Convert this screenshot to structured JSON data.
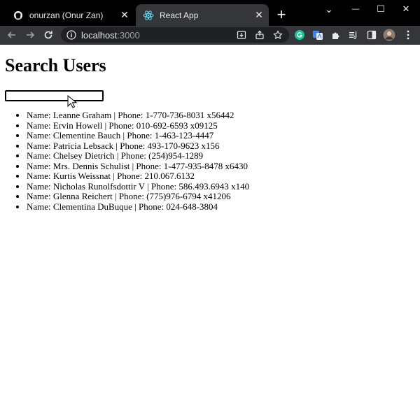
{
  "browser": {
    "tabs": [
      {
        "title": "onurzan (Onur Zan)",
        "icon": "github-icon",
        "active": false
      },
      {
        "title": "React App",
        "icon": "react-icon",
        "active": true
      }
    ],
    "close_glyph": "✕",
    "new_tab_glyph": "+",
    "address": {
      "host": "localhost",
      "port": ":3000"
    },
    "window_controls": {
      "minimize": "—",
      "maximize": "☐",
      "close": "✕",
      "expand": "⌄"
    },
    "colors": {
      "tabstrip": "#000000",
      "toolbar": "#35363a",
      "grammarly": "#15c39a",
      "translate": "#4285f4"
    }
  },
  "page": {
    "heading": "Search Users",
    "search": {
      "value": "",
      "placeholder": ""
    },
    "users": [
      {
        "name": "Leanne Graham",
        "phone": "1-770-736-8031 x56442"
      },
      {
        "name": "Ervin Howell",
        "phone": "010-692-6593 x09125"
      },
      {
        "name": "Clementine Bauch",
        "phone": "1-463-123-4447"
      },
      {
        "name": "Patricia Lebsack",
        "phone": "493-170-9623 x156"
      },
      {
        "name": "Chelsey Dietrich",
        "phone": "(254)954-1289"
      },
      {
        "name": "Mrs. Dennis Schulist",
        "phone": "1-477-935-8478 x6430"
      },
      {
        "name": "Kurtis Weissnat",
        "phone": "210.067.6132"
      },
      {
        "name": "Nicholas Runolfsdottir V",
        "phone": "586.493.6943 x140"
      },
      {
        "name": "Glenna Reichert",
        "phone": "(775)976-6794 x41206"
      },
      {
        "name": "Clementina DuBuque",
        "phone": "024-648-3804"
      }
    ]
  }
}
